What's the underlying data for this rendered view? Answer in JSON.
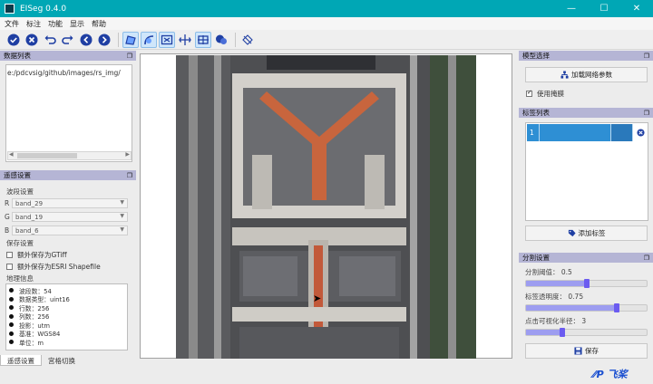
{
  "app": {
    "title": "EISeg 0.4.0"
  },
  "window_controls": {
    "minimize": "—",
    "maximize": "☐",
    "close": "✕"
  },
  "menu": [
    "文件",
    "标注",
    "功能",
    "显示",
    "帮助"
  ],
  "toolbar_icons": [
    "accept-icon",
    "cancel-icon",
    "undo-icon",
    "redo-icon",
    "prev-image-icon",
    "next-image-icon",
    "polygon-icon",
    "polygon-edit-icon",
    "fit-icon",
    "zoom-fit-icon",
    "grid-icon",
    "label-icon",
    "language-icon"
  ],
  "data_list": {
    "title": "数据列表",
    "path": "e:/pdcvsig/github/images/rs_img/"
  },
  "rs_settings": {
    "title": "遥感设置",
    "band_label": "波段设置",
    "bands": [
      {
        "channel": "R",
        "value": "band_29"
      },
      {
        "channel": "G",
        "value": "band_19"
      },
      {
        "channel": "B",
        "value": "band_6"
      }
    ],
    "save_label": "保存设置",
    "save_gtiff": "额外保存为GTiff",
    "save_shp": "额外保存为ESRI Shapefile",
    "geo_label": "地理信息",
    "geo_info": [
      "波段数：54",
      "数据类型：uint16",
      "行数：256",
      "列数：256",
      "投影：utm",
      "基准：WGS84",
      "单位：m"
    ]
  },
  "bottom_tabs": [
    "遥感设置",
    "宫格切换"
  ],
  "model": {
    "title": "模型选择",
    "load_button": "加载网络参数",
    "use_gpu": "使用掩膜",
    "use_gpu_checked": true
  },
  "labels": {
    "title": "标签列表",
    "rows": [
      {
        "id": "1",
        "name": "",
        "color": "#2a79bb"
      }
    ],
    "add_button": "添加标签"
  },
  "segmentation": {
    "title": "分割设置",
    "threshold_label": "分割阈值：",
    "threshold_value": "0.5",
    "threshold": 0.5,
    "opacity_label": "标签透明度：",
    "opacity_value": "0.75",
    "opacity": 0.75,
    "radius_label": "点击可视化半径：",
    "radius_value": "3",
    "radius_fraction": 0.3,
    "save_button": "保存"
  },
  "logo": "飞桨"
}
